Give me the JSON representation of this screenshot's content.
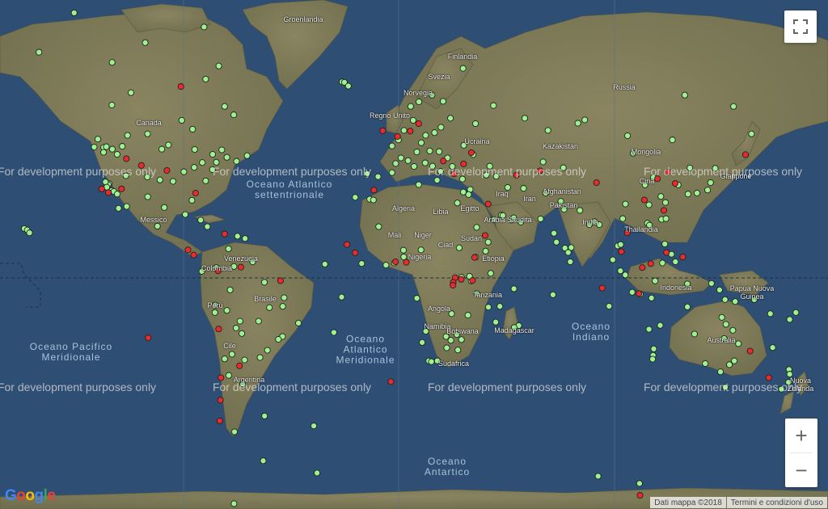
{
  "map": {
    "type": "world_map",
    "land_color": "#7f7d58",
    "ocean_color": "#2e4f73",
    "marker_colors": {
      "green": "#9cf28f",
      "red": "#ea2b2b"
    },
    "watermark": "For development purposes only",
    "zoom_in_label": "+",
    "zoom_out_label": "−",
    "fullscreen_icon": "fullscreen-icon",
    "attribution": {
      "map_data": "Dati mappa ©2018",
      "terms": "Termini e condizioni d'uso",
      "logo": "Google"
    },
    "country_labels": [
      "Groenlandia",
      "Canada",
      "Messico",
      "Venezuela",
      "Colombia",
      "Perù",
      "Brasile",
      "Cile",
      "Argentina",
      "Finlandia",
      "Svezia",
      "Norvegia",
      "Regno Unito",
      "Ucraina",
      "Russia",
      "Kazakistan",
      "Mongolia",
      "Cina",
      "Afghanistan",
      "Pakistan",
      "India",
      "Iran",
      "Iraq",
      "Arabia Saudita",
      "Algeria",
      "Libia",
      "Egitto",
      "Mali",
      "Niger",
      "Ciad",
      "Sudan",
      "Nigeria",
      "Etiopia",
      "Tanzania",
      "Angola",
      "Namibia",
      "Botswana",
      "Madagascar",
      "Sudafrica",
      "Thailandia",
      "Indonesia",
      "Papua Nuova Guinea",
      "Australia",
      "Nuova Zelanda",
      "Giappone"
    ],
    "ocean_labels": [
      "Oceano Atlantico settentrionale",
      "Oceano Pacifico Meridionale",
      "Oceano Atlantico Meridionale",
      "Oceano Indiano",
      "Oceano Antartico"
    ],
    "markers": {
      "green": [
        [
          -75.4,
          79.6
        ],
        [
          -72.9,
          67.4
        ],
        [
          -135.8,
          74.8
        ],
        [
          -104.9,
          71.0
        ],
        [
          -79.3,
          73.1
        ],
        [
          -151.1,
          69.6
        ],
        [
          -119.3,
          68.0
        ],
        [
          -78.6,
          65.1
        ],
        [
          -111.1,
          62.5
        ],
        [
          -119.4,
          59.9
        ],
        [
          -70.4,
          59.6
        ],
        [
          -66.4,
          57.7
        ],
        [
          -89.0,
          56.4
        ],
        [
          -84.3,
          54.2
        ],
        [
          -123.0,
          49.3
        ],
        [
          -125.5,
          51.6
        ],
        [
          -121.8,
          49.5
        ],
        [
          -123.0,
          47.9
        ],
        [
          -127.1,
          49.4
        ],
        [
          -119.2,
          48.8
        ],
        [
          -117.1,
          47.3
        ],
        [
          -114.9,
          49.6
        ],
        [
          -112.6,
          52.6
        ],
        [
          -103.9,
          53.0
        ],
        [
          -94.8,
          50.0
        ],
        [
          -97.7,
          48.8
        ],
        [
          -83.4,
          48.7
        ],
        [
          -75.6,
          47.3
        ],
        [
          -71.6,
          48.6
        ],
        [
          -69.4,
          46.4
        ],
        [
          -74.0,
          44.9
        ],
        [
          -75.7,
          42.6
        ],
        [
          -80.1,
          44.8
        ],
        [
          -83.6,
          43.3
        ],
        [
          -88.1,
          41.9
        ],
        [
          -65.2,
          45.2
        ],
        [
          -60.6,
          46.9
        ],
        [
          -78.6,
          38.9
        ],
        [
          -92.8,
          38.7
        ],
        [
          -98.5,
          39.2
        ],
        [
          -104.0,
          40.2
        ],
        [
          -113.3,
          40.6
        ],
        [
          -120.5,
          37.9
        ],
        [
          -121.0,
          37.6
        ],
        [
          -122.2,
          38.5
        ],
        [
          -121.6,
          36.7
        ],
        [
          -119.5,
          35.5
        ],
        [
          -118.5,
          35.2
        ],
        [
          -117.1,
          34.3
        ],
        [
          -103.8,
          33.3
        ],
        [
          -113.0,
          29.7
        ],
        [
          -116.5,
          29.0
        ],
        [
          -96.6,
          29.3
        ],
        [
          -84.6,
          32.0
        ],
        [
          -87.5,
          26.6
        ],
        [
          -99.6,
          22.0
        ],
        [
          -80.8,
          24.4
        ],
        [
          -77.9,
          21.8
        ],
        [
          -157.5,
          21.0
        ],
        [
          -156.2,
          20.4
        ],
        [
          -155.2,
          19.3
        ],
        [
          -61.5,
          16.9
        ],
        [
          -64.8,
          17.9
        ],
        [
          -68.7,
          12.6
        ],
        [
          -80.3,
          2.9
        ],
        [
          -74.0,
          4.5
        ],
        [
          -66.3,
          5.0
        ],
        [
          -58.2,
          7.0
        ],
        [
          -53.1,
          -1.9
        ],
        [
          -68.0,
          -5.2
        ],
        [
          -74.5,
          -11.7
        ],
        [
          -74.6,
          -14.9
        ],
        [
          -69.4,
          -14.0
        ],
        [
          -63.7,
          -18.5
        ],
        [
          -65.4,
          -21.3
        ],
        [
          -62.9,
          -23.5
        ],
        [
          -55.6,
          -18.5
        ],
        [
          -50.9,
          -12.8
        ],
        [
          -44.5,
          -8.6
        ],
        [
          -45.1,
          -12.3
        ],
        [
          -38.3,
          -19.3
        ],
        [
          -45.2,
          -24.7
        ],
        [
          -47.0,
          -25.8
        ],
        [
          -51.8,
          -30.0
        ],
        [
          -55.0,
          -32.7
        ],
        [
          -67.2,
          -31.5
        ],
        [
          -70.4,
          -33.2
        ],
        [
          -68.6,
          -39.0
        ],
        [
          -61.7,
          -33.6
        ],
        [
          -62.5,
          -41.9
        ],
        [
          -66.1,
          -55.5
        ],
        [
          -53.0,
          -51.4
        ],
        [
          -53.6,
          -62.0
        ],
        [
          -66.3,
          -69.6
        ],
        [
          -31.6,
          -54.0
        ],
        [
          -22.9,
          -23.1
        ],
        [
          -19.3,
          64.6
        ],
        [
          -18.3,
          64.5
        ],
        [
          -16.6,
          63.8
        ],
        [
          -13.6,
          33.1
        ],
        [
          -7.3,
          32.4
        ],
        [
          -5.7,
          32.1
        ],
        [
          -3.4,
          21.8
        ],
        [
          -26.8,
          6.0
        ],
        [
          -19.5,
          -8.3
        ],
        [
          2.4,
          49.7
        ],
        [
          5.2,
          51.4
        ],
        [
          7.6,
          53.9
        ],
        [
          11.6,
          56.4
        ],
        [
          10.5,
          59.6
        ],
        [
          14.1,
          60.6
        ],
        [
          19.8,
          62.0
        ],
        [
          24.6,
          60.7
        ],
        [
          27.8,
          56.9
        ],
        [
          23.7,
          54.7
        ],
        [
          20.9,
          53.3
        ],
        [
          17.0,
          52.6
        ],
        [
          15.1,
          50.6
        ],
        [
          13.2,
          48.0
        ],
        [
          18.8,
          48.3
        ],
        [
          22.9,
          48.1
        ],
        [
          26.5,
          46.2
        ],
        [
          28.6,
          43.6
        ],
        [
          23.5,
          42.0
        ],
        [
          20.0,
          43.7
        ],
        [
          16.8,
          44.7
        ],
        [
          12.0,
          43.6
        ],
        [
          9.4,
          45.4
        ],
        [
          6.3,
          46.2
        ],
        [
          4.0,
          44.5
        ],
        [
          2.4,
          41.6
        ],
        [
          -3.7,
          40.3
        ],
        [
          -8.4,
          41.3
        ],
        [
          14.0,
          37.6
        ],
        [
          22.0,
          39.1
        ],
        [
          33.4,
          35.0
        ],
        [
          33.0,
          39.5
        ],
        [
          30.8,
          31.0
        ],
        [
          36.4,
          35.9
        ],
        [
          35.7,
          34.1
        ],
        [
          43.4,
          40.8
        ],
        [
          47.7,
          40.4
        ],
        [
          44.9,
          43.7
        ],
        [
          37.7,
          47.2
        ],
        [
          33.6,
          49.9
        ],
        [
          38.7,
          55.6
        ],
        [
          46.5,
          59.8
        ],
        [
          33.3,
          67.0
        ],
        [
          60.1,
          56.9
        ],
        [
          70.2,
          53.9
        ],
        [
          68.1,
          45.0
        ],
        [
          76.9,
          43.2
        ],
        [
          86.2,
          56.5
        ],
        [
          83.2,
          55.7
        ],
        [
          104.8,
          52.5
        ],
        [
          107.2,
          47.6
        ],
        [
          116.0,
          40.0
        ],
        [
          112.4,
          37.5
        ],
        [
          119.3,
          33.4
        ],
        [
          121.3,
          31.2
        ],
        [
          114.1,
          30.3
        ],
        [
          103.9,
          30.6
        ],
        [
          102.7,
          25.0
        ],
        [
          113.4,
          23.2
        ],
        [
          114.3,
          22.4
        ],
        [
          119.6,
          24.7
        ],
        [
          121.5,
          25.0
        ],
        [
          126.8,
          37.5
        ],
        [
          131.1,
          34.3
        ],
        [
          135.0,
          34.6
        ],
        [
          139.6,
          35.7
        ],
        [
          140.9,
          38.3
        ],
        [
          142.9,
          43.0
        ],
        [
          92.5,
          22.6
        ],
        [
          88.2,
          22.6
        ],
        [
          77.2,
          28.6
        ],
        [
          72.8,
          19.1
        ],
        [
          73.9,
          15.4
        ],
        [
          77.6,
          12.9
        ],
        [
          80.3,
          13.1
        ],
        [
          79.9,
          7.0
        ],
        [
          90.4,
          23.8
        ],
        [
          100.5,
          13.8
        ],
        [
          101.8,
          14.4
        ],
        [
          98.4,
          7.9
        ],
        [
          101.7,
          3.1
        ],
        [
          103.8,
          1.3
        ],
        [
          106.8,
          -6.2
        ],
        [
          110.4,
          -7.0
        ],
        [
          115.2,
          -8.7
        ],
        [
          116.8,
          -1.3
        ],
        [
          120.0,
          6.5
        ],
        [
          121.0,
          14.6
        ],
        [
          123.9,
          10.3
        ],
        [
          125.6,
          7.0
        ],
        [
          130.8,
          -2.6
        ],
        [
          141.3,
          -2.4
        ],
        [
          144.8,
          -5.2
        ],
        [
          147.2,
          -9.4
        ],
        [
          151.6,
          -10.2
        ],
        [
          159.9,
          -9.4
        ],
        [
          166.9,
          -15.4
        ],
        [
          175.3,
          -17.8
        ],
        [
          178.0,
          -14.9
        ],
        [
          171.7,
          -43.5
        ],
        [
          174.8,
          -41.3
        ],
        [
          175.0,
          -37.0
        ],
        [
          167.9,
          -29.0
        ],
        [
          145.2,
          -37.8
        ],
        [
          147.3,
          -42.9
        ],
        [
          151.2,
          -33.9
        ],
        [
          153.0,
          -27.5
        ],
        [
          149.1,
          -35.3
        ],
        [
          145.8,
          -16.9
        ],
        [
          138.6,
          -34.9
        ],
        [
          133.9,
          -23.7
        ],
        [
          130.8,
          -12.5
        ],
        [
          115.9,
          -31.9
        ],
        [
          116.2,
          -29.5
        ],
        [
          114.1,
          -21.8
        ],
        [
          119.0,
          -20.2
        ],
        [
          150.6,
          -22.2
        ],
        [
          147.6,
          -19.8
        ],
        [
          146.8,
          -25.5
        ],
        [
          115.7,
          -33.3
        ],
        [
          96.8,
          -12.2
        ],
        [
          72.4,
          -7.3
        ],
        [
          55.4,
          -4.7
        ],
        [
          57.5,
          -20.3
        ],
        [
          55.5,
          -21.1
        ],
        [
          47.5,
          -18.9
        ],
        [
          49.3,
          -12.3
        ],
        [
          44.3,
          -12.6
        ],
        [
          39.3,
          -6.8
        ],
        [
          36.8,
          -1.3
        ],
        [
          32.6,
          0.3
        ],
        [
          38.8,
          9.0
        ],
        [
          45.3,
          2.0
        ],
        [
          43.1,
          11.6
        ],
        [
          31.6,
          13.0
        ],
        [
          15.0,
          12.1
        ],
        [
          7.5,
          9.1
        ],
        [
          3.4,
          6.5
        ],
        [
          -0.2,
          5.6
        ],
        [
          -10.8,
          6.3
        ],
        [
          7.4,
          12.0
        ],
        [
          13.2,
          -8.8
        ],
        [
          17.1,
          -22.6
        ],
        [
          15.5,
          -27.0
        ],
        [
          18.4,
          -33.9
        ],
        [
          19.5,
          -34.2
        ],
        [
          22.1,
          -33.9
        ],
        [
          26.2,
          -29.1
        ],
        [
          28.0,
          -26.2
        ],
        [
          31.0,
          -29.9
        ],
        [
          30.6,
          -23.9
        ],
        [
          25.9,
          -24.7
        ],
        [
          28.3,
          -15.4
        ],
        [
          32.6,
          -25.9
        ],
        [
          35.4,
          -16.0
        ],
        [
          36.1,
          0.7
        ],
        [
          49.9,
          26.4
        ],
        [
          50.6,
          26.2
        ],
        [
          54.4,
          24.4
        ],
        [
          55.3,
          25.3
        ],
        [
          58.4,
          23.6
        ],
        [
          44.2,
          15.4
        ],
        [
          39.2,
          21.5
        ],
        [
          46.7,
          24.7
        ],
        [
          52.7,
          36.6
        ],
        [
          59.6,
          36.3
        ],
        [
          69.2,
          34.6
        ],
        [
          67.0,
          24.9
        ],
        [
          75.8,
          31.6
        ],
        [
          84.1,
          28.2
        ],
        [
          79.0,
          11.0
        ],
        [
          150.9,
          59.6
        ],
        [
          158.7,
          53.0
        ],
        [
          131.9,
          43.1
        ],
        [
          129.7,
          62.0
        ],
        [
          124.3,
          51.4
        ],
        [
          -30.2,
          -64.4
        ],
        [
          110.0,
          -66.3
        ],
        [
          92.0,
          -65.0
        ],
        [
          175.3,
          -38.6
        ]
      ],
      "red": [
        [
          -103.9,
          80.3
        ],
        [
          -89.4,
          63.7
        ],
        [
          -106.6,
          43.9
        ],
        [
          -95.5,
          42.3
        ],
        [
          -83.0,
          34.6
        ],
        [
          -113.1,
          46.0
        ],
        [
          -123.8,
          36.1
        ],
        [
          -120.9,
          34.8
        ],
        [
          -115.2,
          36.1
        ],
        [
          -70.4,
          18.8
        ],
        [
          -83.8,
          9.9
        ],
        [
          -86.3,
          12.1
        ],
        [
          -73.2,
          3.1
        ],
        [
          -63.3,
          4.7
        ],
        [
          -46.1,
          -1.2
        ],
        [
          -73.0,
          -21.7
        ],
        [
          -63.9,
          -35.7
        ],
        [
          -72.0,
          -39.8
        ],
        [
          -72.2,
          -46.9
        ],
        [
          -72.5,
          -52.7
        ],
        [
          -103.6,
          -25.2
        ],
        [
          -17.2,
          14.4
        ],
        [
          -13.6,
          10.9
        ],
        [
          -5.5,
          35.7
        ],
        [
          -1.6,
          53.8
        ],
        [
          4.8,
          52.3
        ],
        [
          10.3,
          53.7
        ],
        [
          14.0,
          55.6
        ],
        [
          24.7,
          45.3
        ],
        [
          29.4,
          41.2
        ],
        [
          36.9,
          47.8
        ],
        [
          33.5,
          44.4
        ],
        [
          3.9,
          7.0
        ],
        [
          8.6,
          6.8
        ],
        [
          29.8,
          0.1
        ],
        [
          32.5,
          -0.6
        ],
        [
          29.0,
          -1.9
        ],
        [
          28.9,
          -3.2
        ],
        [
          37.4,
          -1.1
        ],
        [
          38.3,
          8.9
        ],
        [
          42.9,
          18.2
        ],
        [
          44.2,
          30.6
        ],
        [
          56.5,
          40.8
        ],
        [
          66.8,
          42.2
        ],
        [
          91.3,
          38.3
        ],
        [
          117.8,
          39.6
        ],
        [
          122.3,
          41.8
        ],
        [
          125.5,
          38.0
        ],
        [
          112.1,
          32.1
        ],
        [
          120.6,
          28.2
        ],
        [
          104.7,
          19.3
        ],
        [
          102.1,
          11.4
        ],
        [
          111.2,
          4.5
        ],
        [
          114.9,
          6.2
        ],
        [
          121.7,
          11.0
        ],
        [
          128.8,
          9.1
        ],
        [
          109.8,
          -6.8
        ],
        [
          93.8,
          -4.4
        ],
        [
          156.1,
          47.2
        ],
        [
          158.1,
          -30.3
        ],
        [
          166.2,
          -39.8
        ],
        [
          1.9,
          -41.1
        ],
        [
          110.2,
          -68.3
        ]
      ]
    }
  }
}
